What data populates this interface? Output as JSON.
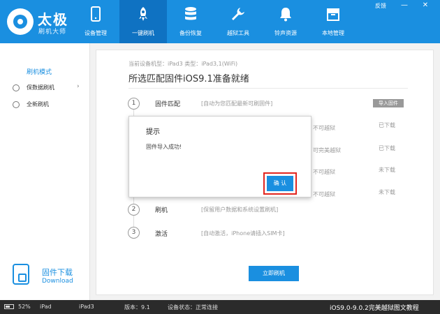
{
  "app": {
    "logo_title": "太极",
    "logo_sub": "刷机大师"
  },
  "nav": [
    {
      "label": "设备管理",
      "icon": "phone-icon"
    },
    {
      "label": "一键刷机",
      "icon": "rocket-icon",
      "active": true
    },
    {
      "label": "备份恢复",
      "icon": "database-icon"
    },
    {
      "label": "越狱工具",
      "icon": "wrench-icon"
    },
    {
      "label": "铃声资源",
      "icon": "bell-icon"
    },
    {
      "label": "本地管理",
      "icon": "box-icon"
    }
  ],
  "window": {
    "feedback": "反馈",
    "minimize": "—",
    "close": "✕"
  },
  "sidebar": {
    "title": "刷机模式",
    "items": [
      {
        "label": "保数据刷机",
        "icon": "check-circle-icon",
        "arrow": "›"
      },
      {
        "label": "全新刷机",
        "icon": "radio-icon"
      }
    ],
    "firmware_download": {
      "label": "固件下载",
      "sub": "Download"
    }
  },
  "main": {
    "device_info": "当前设备机型：iPad3 类型：iPad3,1(WiFi)",
    "heading": "所选匹配固件iOS9.1准备就绪",
    "steps": [
      {
        "num": "1",
        "title": "固件匹配",
        "desc": "[自动为您匹配最新可刷固件]"
      },
      {
        "num": "2",
        "title": "刷机",
        "desc": "[保留用户数据和系统设置刷机]"
      },
      {
        "num": "3",
        "title": "激活",
        "desc": "[自动激活，iPhone请插入SIM卡]"
      }
    ],
    "import_button": "导入固件",
    "subrows": [
      {
        "jb": "不可越狱",
        "status": "已下载"
      },
      {
        "jb": "可完美越狱",
        "status": "已下载"
      },
      {
        "jb": "不可越狱",
        "status": "未下载"
      },
      {
        "jb": "不可越狱",
        "status": "未下载"
      }
    ],
    "start_button": "立即刷机"
  },
  "dialog": {
    "title": "提示",
    "message": "固件导入成功!",
    "ok": "确 认"
  },
  "statusbar": {
    "battery": "52%",
    "device": "iPad",
    "model": "iPad3",
    "version": "版本：9.1",
    "state": "设备状态：正常连接",
    "link": "iOS9.0-9.0.2完美越狱图文教程"
  },
  "colors": {
    "accent": "#1a8fe0",
    "highlight": "#e2251f",
    "statusbar": "#2b2b2b"
  }
}
